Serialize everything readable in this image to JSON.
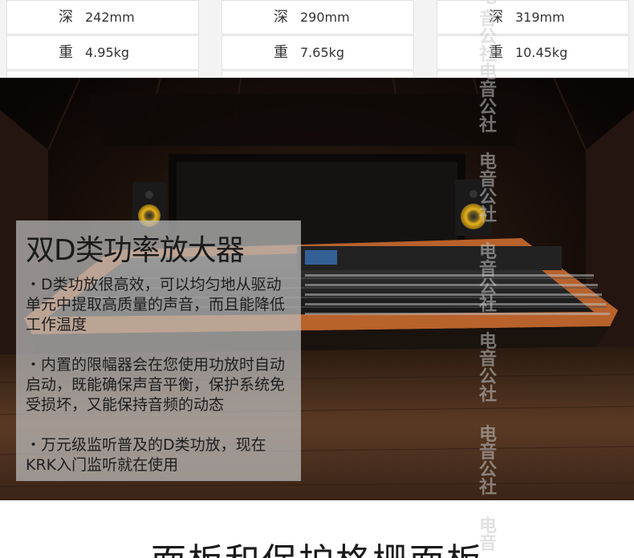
{
  "spec_tables": [
    {
      "rows": [
        {
          "key": "深",
          "value": "242mm"
        },
        {
          "key": "重",
          "value": "4.95kg"
        }
      ]
    },
    {
      "rows": [
        {
          "key": "深",
          "value": "290mm"
        },
        {
          "key": "重",
          "value": "7.65kg"
        }
      ]
    },
    {
      "rows": [
        {
          "key": "深",
          "value": "319mm"
        },
        {
          "key": "重",
          "value": "10.45kg"
        }
      ]
    }
  ],
  "feature": {
    "title": "双D类功率放大器",
    "items": [
      "・D类功放很高效，可以均匀地从驱动单元中提取高质量的声音，而且能降低工作温度",
      "・内置的限幅器会在您使用功放时自动启动，既能确保声音平衡，保护系统免受损坏，又能保持音频的动态",
      "・万元级监听普及的D类功放，现在KRK入门监听就在使用"
    ]
  },
  "section_heading": "面板和保护格栅面板",
  "watermark": {
    "text": [
      "电",
      "音",
      "公",
      "社"
    ]
  },
  "colors": {
    "speaker_cone": "#e8b21c",
    "console_wood": "#b8622c",
    "box_overlay": "rgba(190,190,190,0.72)"
  }
}
